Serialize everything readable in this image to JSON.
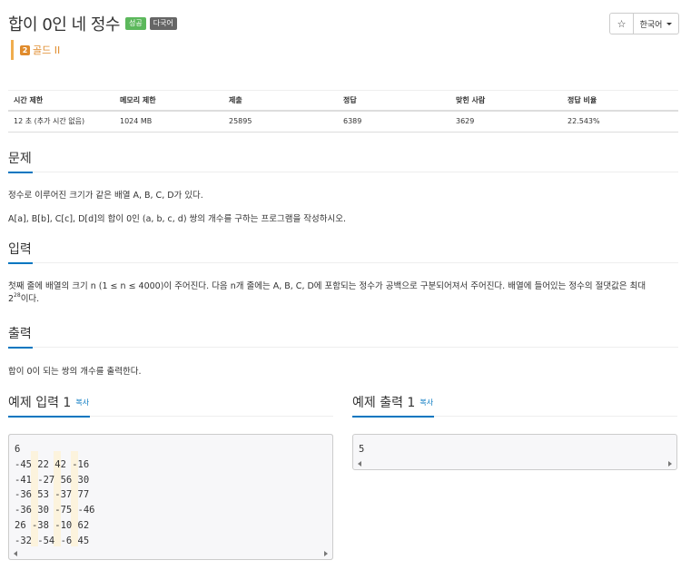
{
  "problem": {
    "title": "합이 0인 네 정수",
    "badges": [
      "성공",
      "다국어"
    ],
    "tier": {
      "icon_text": "2",
      "label": "골드 II"
    }
  },
  "toolbar": {
    "star": "☆",
    "language": "한국어"
  },
  "info_table": {
    "headers": [
      "시간 제한",
      "메모리 제한",
      "제출",
      "정답",
      "맞힌 사람",
      "정답 비율"
    ],
    "row": [
      "12 초 (추가 시간 없음)",
      "1024 MB",
      "25895",
      "6389",
      "3629",
      "22.543%"
    ]
  },
  "sections": {
    "problem_title": "문제",
    "problem_lines": [
      "정수로 이루어진 크기가 같은 배열 A, B, C, D가 있다.",
      "A[a], B[b], C[c], D[d]의 합이 0인 (a, b, c, d) 쌍의 개수를 구하는 프로그램을 작성하시오."
    ],
    "input_title": "입력",
    "input_text_line1": "첫째 줄에 배열의 크기 n (1 ≤ n ≤ 4000)이 주어진다. 다음 n개 줄에는 A, B, C, D에 포함되는 정수가 공백으로 구분되어져서 주어진다. 배열에 들어있는 정수의 절댓값은 최대",
    "input_text_base": "2",
    "input_text_exp": "28",
    "input_text_tail": "이다.",
    "output_title": "출력",
    "output_text": "합이 0이 되는 쌍의 개수를 출력한다."
  },
  "sample_input": {
    "title": "예제 입력 1",
    "copy": "복사",
    "content": "6\n-45 22 42 -16\n-41 -27 56 30\n-36 53 -37 77\n-36 30 -75 -46\n26 -38 -10 62\n-32 -54 -6 45"
  },
  "sample_output": {
    "title": "예제 출력 1",
    "copy": "복사",
    "content": "5"
  }
}
